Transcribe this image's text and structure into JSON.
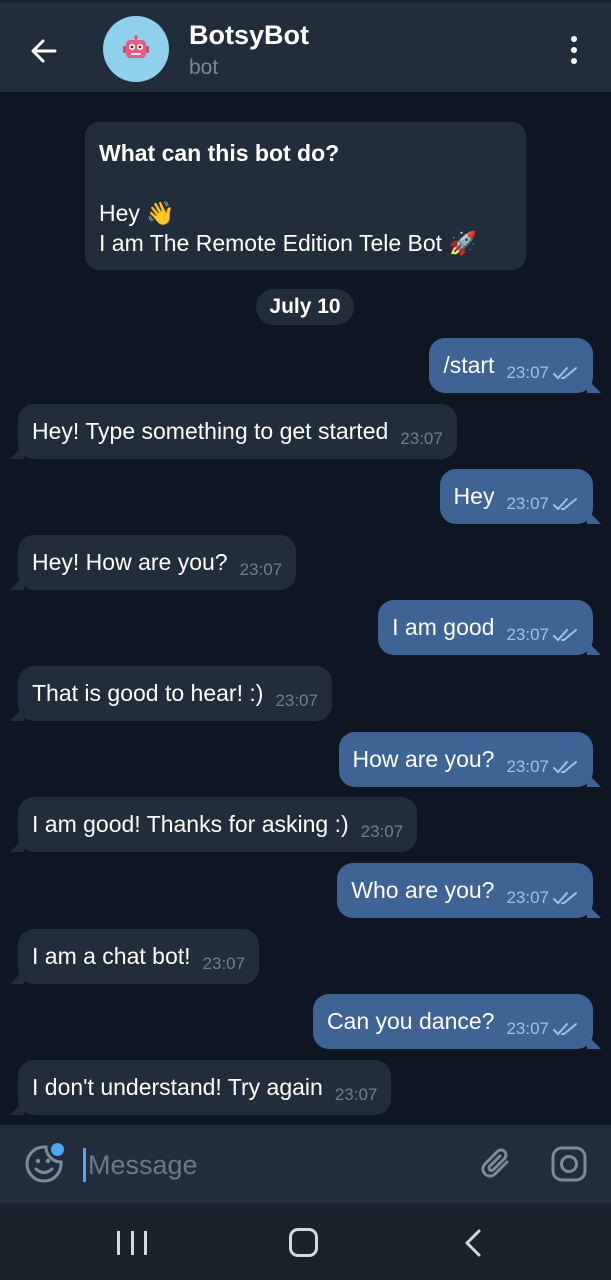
{
  "header": {
    "title": "BotsyBot",
    "subtitle": "bot",
    "back_icon": "arrow-left-icon",
    "avatar_icon": "robot-icon",
    "menu_icon": "more-vertical-icon"
  },
  "intro": {
    "question": "What can this bot do?",
    "line1": "Hey 👋",
    "line2": "I am The Remote Edition Tele Bot 🚀"
  },
  "date_label": "July 10",
  "messages": [
    {
      "dir": "out",
      "text": "/start",
      "time": "23:07"
    },
    {
      "dir": "in",
      "text": "Hey! Type something to get started",
      "time": "23:07"
    },
    {
      "dir": "out",
      "text": "Hey",
      "time": "23:07"
    },
    {
      "dir": "in",
      "text": "Hey! How are you?",
      "time": "23:07"
    },
    {
      "dir": "out",
      "text": "I am good",
      "time": "23:07"
    },
    {
      "dir": "in",
      "text": "That is good to hear! :)",
      "time": "23:07"
    },
    {
      "dir": "out",
      "text": "How are you?",
      "time": "23:07"
    },
    {
      "dir": "in",
      "text": "I am good! Thanks for asking :)",
      "time": "23:07"
    },
    {
      "dir": "out",
      "text": "Who are you?",
      "time": "23:07"
    },
    {
      "dir": "in",
      "text": "I am a chat bot!",
      "time": "23:07"
    },
    {
      "dir": "out",
      "text": "Can you dance?",
      "time": "23:07"
    },
    {
      "dir": "in",
      "text": "I don't understand! Try again",
      "time": "23:07"
    }
  ],
  "input": {
    "placeholder": "Message",
    "emoji_icon": "sticker-icon",
    "attach_icon": "paperclip-icon",
    "camera_icon": "instagram-camera-icon"
  },
  "colors": {
    "background": "#0e1621",
    "bar": "#212d3b",
    "incoming": "#212d3b",
    "outgoing": "#3f6394",
    "accent": "#4ea4f5"
  }
}
